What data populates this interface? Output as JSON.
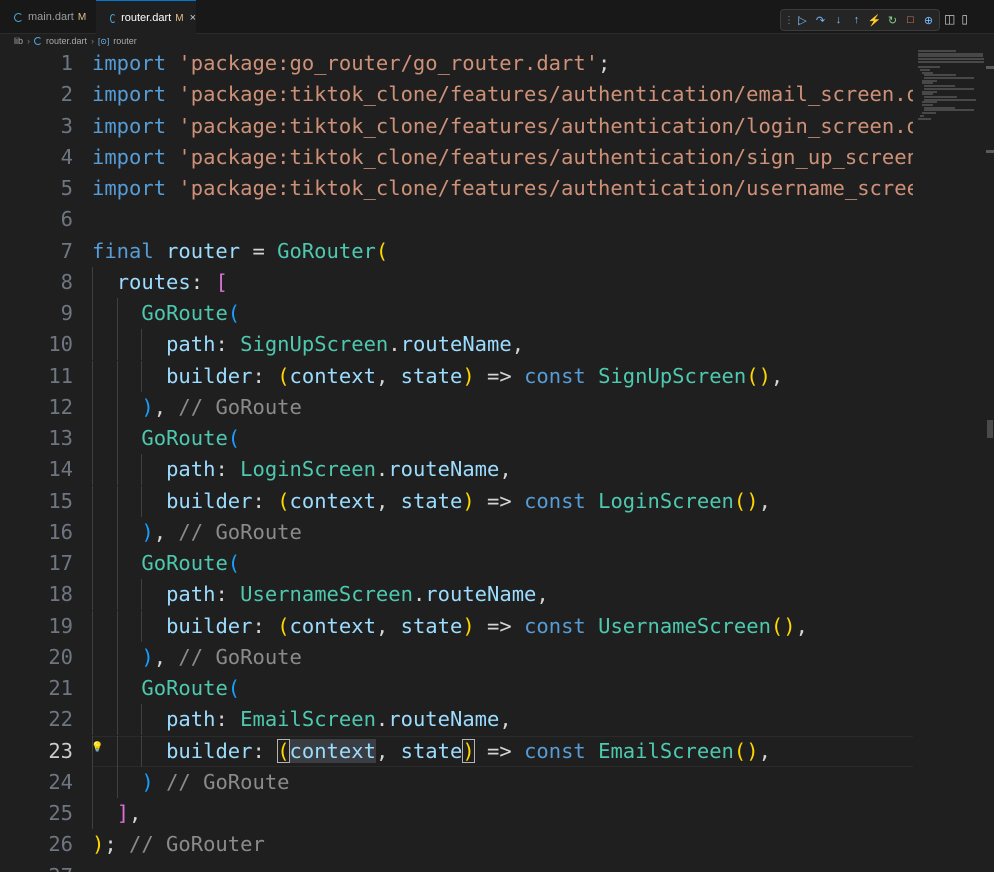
{
  "tabs": [
    {
      "label": "main.dart",
      "modified": "M",
      "active": false
    },
    {
      "label": "router.dart",
      "modified": "M",
      "active": true,
      "close": "×"
    }
  ],
  "breadcrumb": {
    "folder": "lib",
    "file": "router.dart",
    "symbol_icon": "[⊙]",
    "symbol": "router"
  },
  "debug_toolbar": {
    "grip": "⋮⋮",
    "buttons": [
      {
        "name": "continue-icon",
        "glyph": "▷",
        "color": "#75beff"
      },
      {
        "name": "step-over-icon",
        "glyph": "↷",
        "color": "#75beff"
      },
      {
        "name": "step-into-icon",
        "glyph": "↓",
        "color": "#75beff"
      },
      {
        "name": "step-out-icon",
        "glyph": "↑",
        "color": "#75beff"
      },
      {
        "name": "hot-reload-icon",
        "glyph": "⚡",
        "color": "#ffcc00"
      },
      {
        "name": "restart-icon",
        "glyph": "↻",
        "color": "#89d185"
      },
      {
        "name": "stop-icon",
        "glyph": "□",
        "color": "#f48771"
      },
      {
        "name": "devtools-icon",
        "glyph": "⊕",
        "color": "#75beff"
      }
    ]
  },
  "editor_actions": {
    "split": "◫",
    "layout": "▯"
  },
  "code": {
    "active_line": 23,
    "lines": [
      {
        "n": "1",
        "tokens": [
          [
            "kw",
            "import"
          ],
          [
            "op",
            " "
          ],
          [
            "str",
            "'package:go_router/go_router.dart'"
          ],
          [
            "op",
            ";"
          ]
        ]
      },
      {
        "n": "2",
        "tokens": [
          [
            "kw",
            "import"
          ],
          [
            "op",
            " "
          ],
          [
            "str",
            "'package:tiktok_clone/features/authentication/email_screen.dart'"
          ],
          [
            "op",
            ";"
          ]
        ]
      },
      {
        "n": "3",
        "tokens": [
          [
            "kw",
            "import"
          ],
          [
            "op",
            " "
          ],
          [
            "str",
            "'package:tiktok_clone/features/authentication/login_screen.dart'"
          ],
          [
            "op",
            ";"
          ]
        ]
      },
      {
        "n": "4",
        "tokens": [
          [
            "kw",
            "import"
          ],
          [
            "op",
            " "
          ],
          [
            "str",
            "'package:tiktok_clone/features/authentication/sign_up_screen.dart'"
          ],
          [
            "op",
            ";"
          ]
        ]
      },
      {
        "n": "5",
        "tokens": [
          [
            "kw",
            "import"
          ],
          [
            "op",
            " "
          ],
          [
            "str",
            "'package:tiktok_clone/features/authentication/username_screen.dart'"
          ],
          [
            "op",
            ";"
          ]
        ]
      },
      {
        "n": "6",
        "tokens": []
      },
      {
        "n": "7",
        "tokens": [
          [
            "kw",
            "final"
          ],
          [
            "op",
            " "
          ],
          [
            "var",
            "router"
          ],
          [
            "op",
            " = "
          ],
          [
            "cls",
            "GoRouter"
          ],
          [
            "p1",
            "("
          ]
        ]
      },
      {
        "n": "8",
        "indent": 1,
        "tokens": [
          [
            "var",
            "routes"
          ],
          [
            "op",
            ": "
          ],
          [
            "p2",
            "["
          ]
        ]
      },
      {
        "n": "9",
        "indent": 2,
        "tokens": [
          [
            "cls",
            "GoRoute"
          ],
          [
            "p3",
            "("
          ]
        ]
      },
      {
        "n": "10",
        "indent": 3,
        "tokens": [
          [
            "var",
            "path"
          ],
          [
            "op",
            ": "
          ],
          [
            "cls",
            "SignUpScreen"
          ],
          [
            "op",
            "."
          ],
          [
            "var",
            "routeName"
          ],
          [
            "op",
            ","
          ]
        ]
      },
      {
        "n": "11",
        "indent": 3,
        "tokens": [
          [
            "var",
            "builder"
          ],
          [
            "op",
            ": "
          ],
          [
            "p1",
            "("
          ],
          [
            "var",
            "context"
          ],
          [
            "op",
            ", "
          ],
          [
            "var",
            "state"
          ],
          [
            "p1",
            ")"
          ],
          [
            "op",
            " => "
          ],
          [
            "kw",
            "const"
          ],
          [
            "op",
            " "
          ],
          [
            "cls",
            "SignUpScreen"
          ],
          [
            "p1",
            "()"
          ],
          [
            "op",
            ","
          ]
        ]
      },
      {
        "n": "12",
        "indent": 2,
        "tokens": [
          [
            "p3",
            ")"
          ],
          [
            "op",
            ", "
          ],
          [
            "cmt",
            "// GoRoute"
          ]
        ]
      },
      {
        "n": "13",
        "indent": 2,
        "tokens": [
          [
            "cls",
            "GoRoute"
          ],
          [
            "p3",
            "("
          ]
        ]
      },
      {
        "n": "14",
        "indent": 3,
        "tokens": [
          [
            "var",
            "path"
          ],
          [
            "op",
            ": "
          ],
          [
            "cls",
            "LoginScreen"
          ],
          [
            "op",
            "."
          ],
          [
            "var",
            "routeName"
          ],
          [
            "op",
            ","
          ]
        ]
      },
      {
        "n": "15",
        "indent": 3,
        "tokens": [
          [
            "var",
            "builder"
          ],
          [
            "op",
            ": "
          ],
          [
            "p1",
            "("
          ],
          [
            "var",
            "context"
          ],
          [
            "op",
            ", "
          ],
          [
            "var",
            "state"
          ],
          [
            "p1",
            ")"
          ],
          [
            "op",
            " => "
          ],
          [
            "kw",
            "const"
          ],
          [
            "op",
            " "
          ],
          [
            "cls",
            "LoginScreen"
          ],
          [
            "p1",
            "()"
          ],
          [
            "op",
            ","
          ]
        ]
      },
      {
        "n": "16",
        "indent": 2,
        "tokens": [
          [
            "p3",
            ")"
          ],
          [
            "op",
            ", "
          ],
          [
            "cmt",
            "// GoRoute"
          ]
        ]
      },
      {
        "n": "17",
        "indent": 2,
        "tokens": [
          [
            "cls",
            "GoRoute"
          ],
          [
            "p3",
            "("
          ]
        ]
      },
      {
        "n": "18",
        "indent": 3,
        "tokens": [
          [
            "var",
            "path"
          ],
          [
            "op",
            ": "
          ],
          [
            "cls",
            "UsernameScreen"
          ],
          [
            "op",
            "."
          ],
          [
            "var",
            "routeName"
          ],
          [
            "op",
            ","
          ]
        ]
      },
      {
        "n": "19",
        "indent": 3,
        "tokens": [
          [
            "var",
            "builder"
          ],
          [
            "op",
            ": "
          ],
          [
            "p1",
            "("
          ],
          [
            "var",
            "context"
          ],
          [
            "op",
            ", "
          ],
          [
            "var",
            "state"
          ],
          [
            "p1",
            ")"
          ],
          [
            "op",
            " => "
          ],
          [
            "kw",
            "const"
          ],
          [
            "op",
            " "
          ],
          [
            "cls",
            "UsernameScreen"
          ],
          [
            "p1",
            "()"
          ],
          [
            "op",
            ","
          ]
        ]
      },
      {
        "n": "20",
        "indent": 2,
        "tokens": [
          [
            "p3",
            ")"
          ],
          [
            "op",
            ", "
          ],
          [
            "cmt",
            "// GoRoute"
          ]
        ]
      },
      {
        "n": "21",
        "indent": 2,
        "tokens": [
          [
            "cls",
            "GoRoute"
          ],
          [
            "p3",
            "("
          ]
        ]
      },
      {
        "n": "22",
        "indent": 3,
        "tokens": [
          [
            "var",
            "path"
          ],
          [
            "op",
            ": "
          ],
          [
            "cls",
            "EmailScreen"
          ],
          [
            "op",
            "."
          ],
          [
            "var",
            "routeName"
          ],
          [
            "op",
            ","
          ]
        ]
      },
      {
        "n": "23",
        "indent": 3,
        "tokens": [
          [
            "var",
            "builder"
          ],
          [
            "op",
            ": "
          ],
          [
            "p1 pbox",
            "("
          ],
          [
            "var hl",
            "context"
          ],
          [
            "op",
            ", "
          ],
          [
            "var",
            "state"
          ],
          [
            "p1 pbox",
            ")"
          ],
          [
            "op",
            " => "
          ],
          [
            "kw",
            "const"
          ],
          [
            "op",
            " "
          ],
          [
            "cls",
            "EmailScreen"
          ],
          [
            "p1",
            "()"
          ],
          [
            "op",
            ","
          ]
        ]
      },
      {
        "n": "24",
        "indent": 2,
        "tokens": [
          [
            "p3",
            ")"
          ],
          [
            "op",
            " "
          ],
          [
            "cmt",
            "// GoRoute"
          ]
        ]
      },
      {
        "n": "25",
        "indent": 1,
        "tokens": [
          [
            "p2",
            "]"
          ],
          [
            "op",
            ","
          ]
        ]
      },
      {
        "n": "26",
        "tokens": [
          [
            "p1",
            ")"
          ],
          [
            "op",
            "; "
          ],
          [
            "cmt",
            "// GoRouter"
          ]
        ]
      },
      {
        "n": "27",
        "tokens": []
      }
    ]
  },
  "lightbulb": "💡"
}
